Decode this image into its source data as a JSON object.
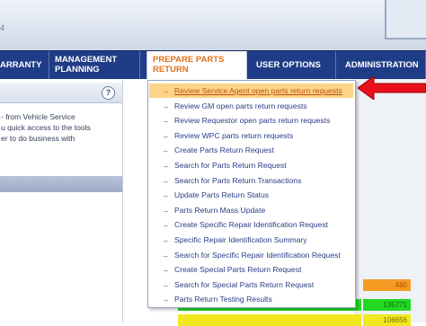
{
  "header": {
    "partial_text": "4"
  },
  "nav": {
    "tabs": [
      {
        "label": "ARRANTY"
      },
      {
        "label": "MANAGEMENT PLANNING"
      },
      {
        "label": "PREPARE PARTS RETURN"
      },
      {
        "label": "USER OPTIONS"
      },
      {
        "label": "ADMINISTRATION"
      }
    ]
  },
  "left_panel": {
    "help_icon": "?",
    "lines": [
      "- from Vehicle Service",
      "u quick access to the tools",
      "er to do business with"
    ]
  },
  "menu": {
    "arrow": "→",
    "items": [
      "Review Service Agent open parts return requests",
      "Review GM open parts return requests",
      "Review Requestor open parts return requests",
      "Review WPC parts return requests",
      "Create Parts Return Request",
      "Search for Parts Return Request",
      "Search for Parts Return Transactions",
      "Update Parts Return Status",
      "Parts Return Mass Update",
      "Create Specific Repair Identification Request",
      "Specific Repair Identification Summary",
      "Search for Specific Repair Identification Request",
      "Create Special Parts Return Request",
      "Search for Special Parts Return Request",
      "Parts Return Testing Results"
    ],
    "highlighted_index": 0
  },
  "background_values": {
    "orange": "480",
    "green": "135771",
    "yellow": "106656"
  },
  "colors": {
    "nav": "#1f3c86",
    "active_tab_text": "#e0701a",
    "highlight": "#fbd488",
    "pointer": "#e8101a"
  }
}
